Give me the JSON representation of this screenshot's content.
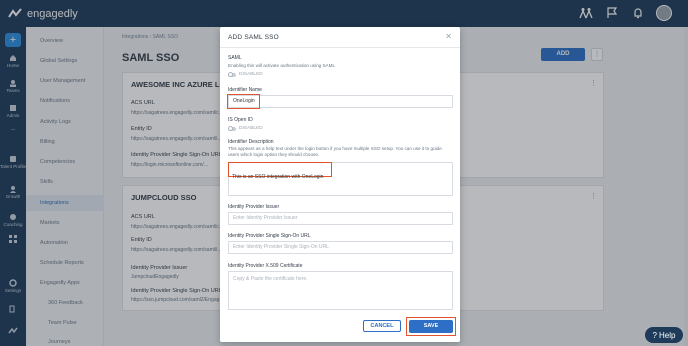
{
  "app": {
    "name": "engagedly"
  },
  "rail": {
    "items": [
      {
        "label": "Home"
      },
      {
        "label": "Teams"
      },
      {
        "label": "Admin"
      },
      {
        "label": "Talent Profile"
      },
      {
        "label": "Growth"
      },
      {
        "label": "Coaching"
      },
      {
        "label": "Settings"
      }
    ]
  },
  "submenu": {
    "items": [
      "Overview",
      "Global Settings",
      "User Management",
      "Notifications",
      "Activity Logs",
      "Billing",
      "Competencies",
      "Skills",
      "Integrations",
      "Markets",
      "Automation",
      "Schedule Reports",
      "Engagedly Apps"
    ],
    "active": "Integrations",
    "sub_items": [
      "360 Feedback",
      "Team Pulse",
      "Journeys"
    ]
  },
  "main": {
    "breadcrumb": "Integrations  ›  SAML SSO",
    "title": "SAML SSO",
    "add_label": "ADD",
    "cards": [
      {
        "title": "AWESOME INC AZURE LOGIN",
        "fields": [
          {
            "label": "ACS URL",
            "value": "https://sagatrees.engagedly.com/saml/c..."
          },
          {
            "label": "Entity ID",
            "value": "https://sagatrees.engagedly.com/saml/i..."
          },
          {
            "label": "Identity Provider Single Sign-On URL",
            "value": "https://login.microsoftonline.com/..."
          }
        ]
      },
      {
        "title": "JUMPCLOUD SSO",
        "fields": [
          {
            "label": "ACS URL",
            "value": "https://sagatrees.engagedly.com/saml/c..."
          },
          {
            "label": "Entity ID",
            "value": "https://sagatrees.engagedly.com/saml/i..."
          },
          {
            "label": "Identity Provider Issuer",
            "value": "JumpcloudEngagedly"
          },
          {
            "label": "Identity Provider Single Sign-On URL",
            "value": "https://sso.jumpcloud.com/saml2/Engag..."
          }
        ]
      }
    ]
  },
  "modal": {
    "title": "ADD SAML SSO",
    "saml_label": "SAML",
    "saml_help": "Enabling this will activate authentication using SAML",
    "saml_toggle": "DISABLED",
    "identifier_name_label": "Identifier Name",
    "identifier_name_value": "OneLogin",
    "open_id_label": "IS Open ID",
    "open_id_toggle": "DISABLED",
    "identifier_desc_label": "Identifier Description",
    "identifier_desc_help": "This appears as a help text under the login button if you have multiple SSO setup. You can use it to guide users which login option they should choose.",
    "identifier_desc_value": "This is an SSO integration with OneLogin",
    "issuer_label": "Identity Provider Issuer",
    "issuer_placeholder": "Enter Identity Provider Issuer",
    "sso_url_label": "Identity Provider Single Sign-On URL",
    "sso_url_placeholder": "Enter Identity Provider Single Sign-On URL",
    "cert_label": "Identity Provider X.509 Certificate",
    "cert_placeholder": "Copy & Paste the certificate here.",
    "cancel_label": "CANCEL",
    "save_label": "SAVE"
  },
  "help": {
    "label": "Help"
  },
  "colors": {
    "brand_navy": "#1e3b5a",
    "primary": "#2d6fc6",
    "highlight": "#e0542e"
  }
}
